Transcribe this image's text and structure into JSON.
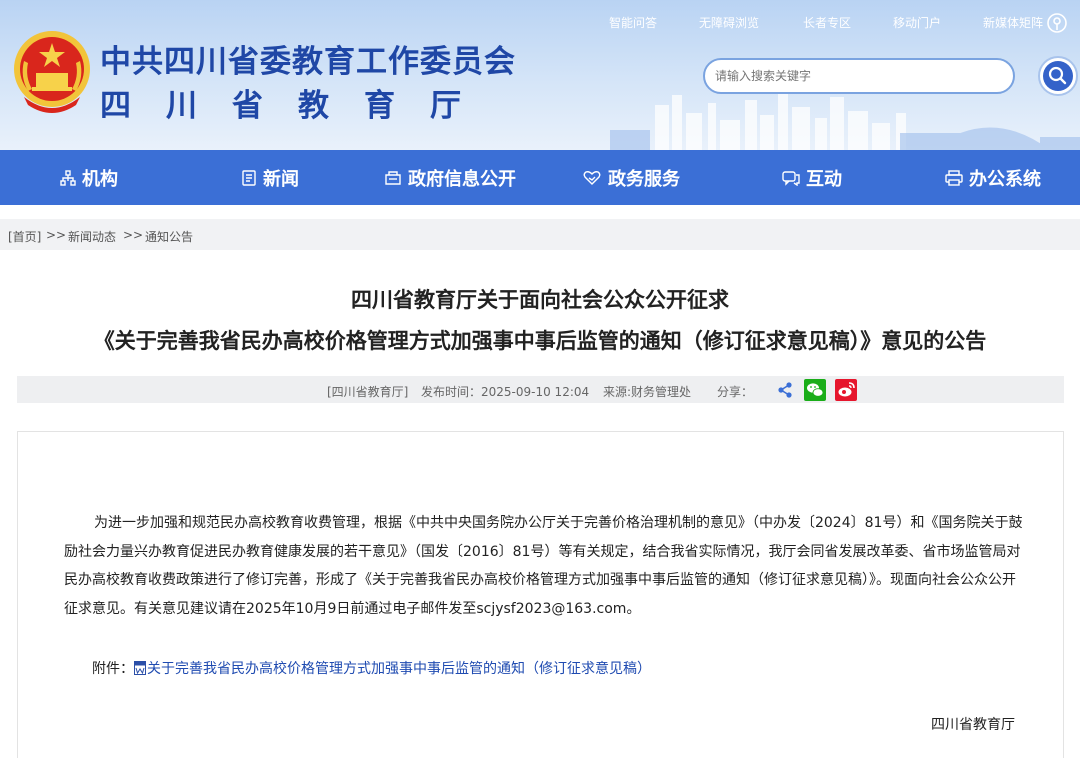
{
  "header": {
    "title_main": "中共四川省委教育工作委员会",
    "title_sub": "四川省教育厅",
    "top_links": [
      "智能问答",
      "无障碍浏览",
      "长者专区",
      "移动门户",
      "新媒体矩阵"
    ],
    "search": {
      "placeholder": "请输入搜索关键字"
    }
  },
  "nav": {
    "items": [
      {
        "label": "机构",
        "icon": "org-chart-icon"
      },
      {
        "label": "新闻",
        "icon": "news-icon"
      },
      {
        "label": "政府信息公开",
        "icon": "gov-info-icon"
      },
      {
        "label": "政务服务",
        "icon": "service-heart-icon"
      },
      {
        "label": "互动",
        "icon": "chat-icon"
      },
      {
        "label": "办公系统",
        "icon": "printer-icon"
      }
    ]
  },
  "breadcrumb": {
    "home": "[首页]",
    "sep": ">>",
    "level1": "新闻动态",
    "level2": "通知公告"
  },
  "article": {
    "title_line1": "四川省教育厅关于面向社会公众公开征求",
    "title_line2": "《关于完善我省民办高校价格管理方式加强事中事后监管的通知（修订征求意见稿）》意见的公告",
    "meta": {
      "source_tag": "[四川省教育厅]",
      "publish_time": "发布时间：2025-09-10 12:04",
      "origin": "来源:财务管理处",
      "share_label": "分享："
    },
    "body": "为进一步加强和规范民办高校教育收费管理，根据《中共中央国务院办公厅关于完善价格治理机制的意见》（中办发〔2024〕81号）和《国务院关于鼓励社会力量兴办教育促进民办教育健康发展的若干意见》（国发〔2016〕81号）等有关规定，结合我省实际情况，我厅会同省发展改革委、省市场监管局对民办高校教育收费政策进行了修订完善，形成了《关于完善我省民办高校价格管理方式加强事中事后监管的通知（修订征求意见稿）》。现面向社会公众公开征求意见。有关意见建议请在2025年10月9日前通过电子邮件发至scjysf2023@163.com。",
    "attachment_label": "附件：",
    "attachment_link": "关于完善我省民办高校价格管理方式加强事中事后监管的通知（修订征求意见稿）",
    "signature": "四川省教育厅"
  },
  "colors": {
    "brand_blue": "#3b6fd6",
    "title_blue": "#1f47a6",
    "wechat_green": "#1aad19",
    "weibo_red": "#e6162d"
  }
}
